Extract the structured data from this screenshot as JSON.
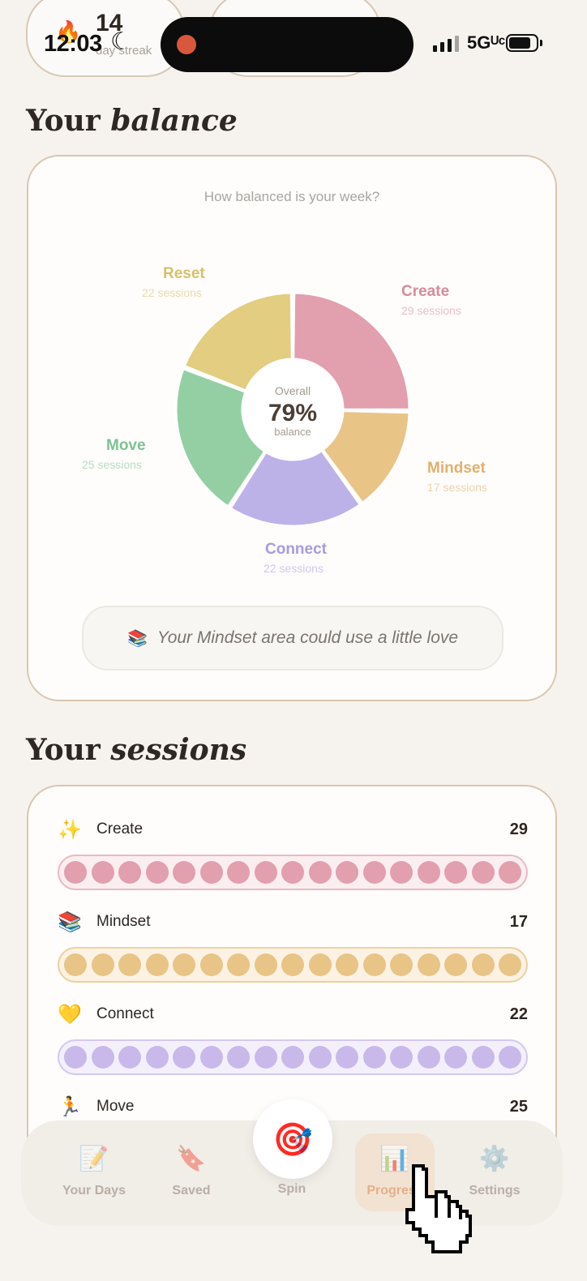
{
  "status_bar": {
    "time": "12:03",
    "network": "5Gᵁᶜ",
    "streak_number": "14",
    "streak_label": "day streak"
  },
  "balance": {
    "title_plain": "Your ",
    "title_italic": "balance",
    "question": "How balanced is your week?",
    "center_top": "Overall",
    "center_value": "79%",
    "center_bottom": "balance",
    "hint_text": "Your Mindset area could use a little love",
    "hint_icon": "books-icon"
  },
  "chart_data": {
    "type": "pie",
    "title": "How balanced is your week?",
    "categories": [
      "Create",
      "Mindset",
      "Connect",
      "Move",
      "Reset"
    ],
    "values": [
      29,
      17,
      22,
      25,
      22
    ],
    "labels": [
      "29 sessions",
      "17 sessions",
      "22 sessions",
      "25 sessions",
      "22 sessions"
    ],
    "colors": [
      "#e29fae",
      "#e8c486",
      "#bdb2e8",
      "#94cfa3",
      "#e2cd80"
    ],
    "center_text": "79%"
  },
  "sessions": {
    "title_plain": "Your ",
    "title_italic": "sessions",
    "rows": [
      {
        "icon": "✨",
        "name": "Create",
        "count": "29",
        "dot_color": "#e29fae",
        "track_bg": "#faeef0",
        "track_border": "#e9b9c3"
      },
      {
        "icon": "📚",
        "name": "Mindset",
        "count": "17",
        "dot_color": "#e8c486",
        "track_bg": "#fbf2e3",
        "track_border": "#ecd0a0"
      },
      {
        "icon": "💛",
        "name": "Connect",
        "count": "22",
        "dot_color": "#c9b9ea",
        "track_bg": "#f4f0fb",
        "track_border": "#d3c8ef"
      },
      {
        "icon": "🏃",
        "name": "Move",
        "count": "25",
        "dot_color": "#94cfa3",
        "track_bg": "#eef8f0",
        "track_border": "#b5ddc0"
      }
    ]
  },
  "nav": {
    "items": [
      {
        "label": "Your Days",
        "icon": "📝"
      },
      {
        "label": "Saved",
        "icon": "🔖"
      },
      {
        "label": "Spin",
        "icon": "🎯"
      },
      {
        "label": "Progress",
        "icon": "📊"
      },
      {
        "label": "Settings",
        "icon": "⚙️"
      }
    ]
  }
}
